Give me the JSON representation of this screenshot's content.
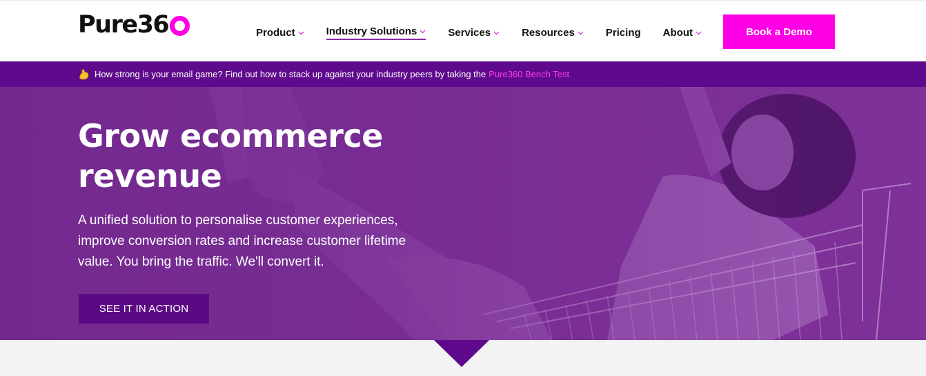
{
  "header": {
    "logo_text": "Pure36",
    "nav": [
      {
        "label": "Product",
        "has_dropdown": true
      },
      {
        "label": "Industry Solutions",
        "has_dropdown": true,
        "active": true
      },
      {
        "label": "Services",
        "has_dropdown": true
      },
      {
        "label": "Resources",
        "has_dropdown": true
      },
      {
        "label": "Pricing",
        "has_dropdown": false
      },
      {
        "label": "About",
        "has_dropdown": true
      }
    ],
    "cta_label": "Book a Demo"
  },
  "banner": {
    "emoji": "flexed-biceps-icon",
    "text": "How strong is your email game? Find out how to stack up against your industry peers by taking the",
    "link_text": "Pure360 Bench Test"
  },
  "hero": {
    "title": "Grow ecommerce revenue",
    "subtitle": "A unified solution to personalise customer experiences, improve conversion rates and increase customer lifetime value. You bring the traffic. We'll convert it.",
    "button_label": "SEE IT IN ACTION"
  },
  "colors": {
    "brand_pink": "#ff00e6",
    "banner_purple": "#5f0a8c",
    "hero_purple": "#7a2e96",
    "hero_button": "#5c0a84"
  }
}
